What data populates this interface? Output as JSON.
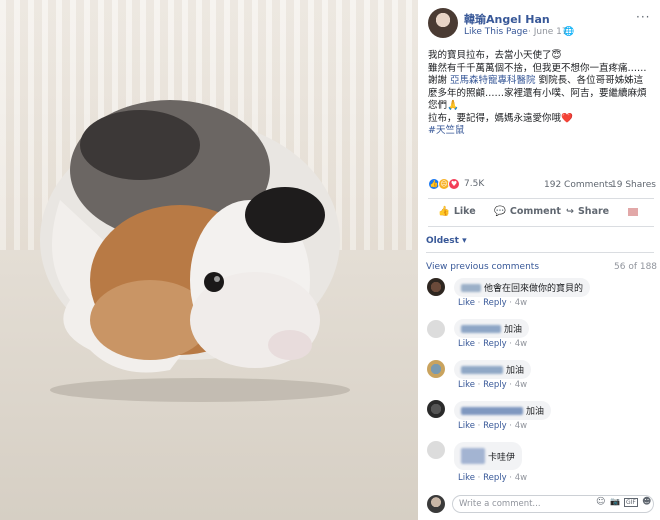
{
  "page": {
    "name": "韓瑜Angel Han",
    "like_label": "Like This Page",
    "date": "· June 17 ·",
    "globe": "🌐",
    "more": "···"
  },
  "post": {
    "lines": [
      "我的寶貝拉布，去當小天使了😇",
      "雖然有千千萬萬個不捨，但我更不想你一直疼痛……",
      "謝謝 ",
      "麼多年的照顧……家裡還有小噗、阿吉，要繼續麻煩",
      "您們🙏",
      "拉布，要記得，媽媽永遠愛你哦❤️"
    ],
    "line3_link": "亞馬森特寵專科醫院",
    "line3_rest": " 劉院長、各位哥哥姊姊這",
    "hashtag": "#天竺鼠"
  },
  "stats": {
    "reactions": "7.5K",
    "comments": "192 Comments",
    "shares": "19 Shares"
  },
  "actions": {
    "like": "Like",
    "comment": "Comment",
    "share": "Share",
    "like_icon": "👍",
    "comment_icon": "💬",
    "share_icon": "↪"
  },
  "comments_section": {
    "sort": "Oldest ▾",
    "view_previous": "View previous comments",
    "count": "56 of 188",
    "items": [
      {
        "text": "他會在回來做你的寶貝的",
        "like": "Like",
        "reply": "Reply",
        "time": "4w"
      },
      {
        "text": "加油",
        "like": "Like",
        "reply": "Reply",
        "time": "4w"
      },
      {
        "text": "加油",
        "like": "Like",
        "reply": "Reply",
        "time": "4w"
      },
      {
        "text": "加油",
        "like": "Like",
        "reply": "Reply",
        "time": "4w"
      },
      {
        "text": "卡哇伊",
        "like": "Like",
        "reply": "Reply",
        "time": "4w"
      }
    ],
    "write_placeholder": "Write a comment...",
    "emoji_icon": "☺",
    "camera_icon": "📷",
    "gif_icon": "GIF",
    "sticker_icon": "☻"
  },
  "colors": {
    "link": "#385898",
    "like_reaction": "#1877f2",
    "love_reaction": "#f33e58",
    "haha_reaction": "#f7b125"
  }
}
